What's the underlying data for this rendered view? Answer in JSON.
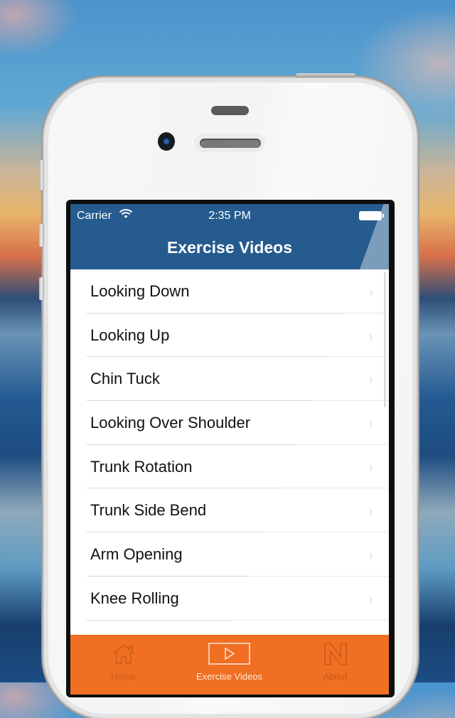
{
  "status_bar": {
    "carrier": "Carrier",
    "time": "2:35 PM",
    "wifi_icon": "wifi-icon",
    "battery_icon": "battery-full-icon"
  },
  "nav": {
    "title": "Exercise Videos"
  },
  "list": {
    "items": [
      {
        "label": "Looking Down",
        "icon": "chevron-right-icon"
      },
      {
        "label": "Looking Up",
        "icon": "chevron-right-icon"
      },
      {
        "label": "Chin Tuck",
        "icon": "chevron-right-icon"
      },
      {
        "label": "Looking Over Shoulder",
        "icon": "chevron-right-icon"
      },
      {
        "label": "Trunk Rotation",
        "icon": "chevron-right-icon"
      },
      {
        "label": "Trunk Side Bend",
        "icon": "chevron-right-icon"
      },
      {
        "label": "Arm Opening",
        "icon": "chevron-right-icon"
      },
      {
        "label": "Knee Rolling",
        "icon": "chevron-right-icon"
      }
    ],
    "chevron_glyph": "›"
  },
  "tabbar": {
    "tabs": [
      {
        "label": "Home",
        "icon": "home-icon",
        "active": false
      },
      {
        "label": "Exercise Videos",
        "icon": "play-video-icon",
        "active": true
      },
      {
        "label": "About",
        "icon": "n-logo-icon",
        "active": false
      }
    ]
  },
  "colors": {
    "nav_background": "#255b8e",
    "tabbar_background": "#f06f22",
    "tab_inactive": "#c95a17",
    "tab_active": "#fde9da"
  }
}
